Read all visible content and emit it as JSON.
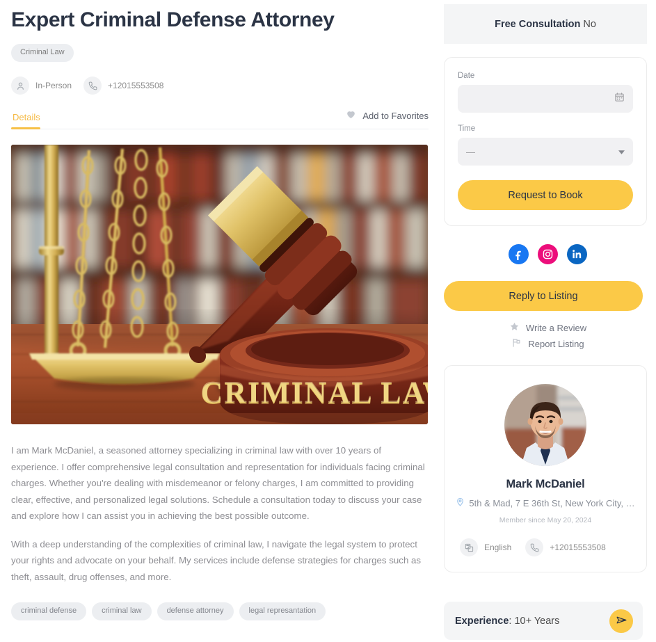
{
  "listing": {
    "title": "Expert Criminal Defense Attorney",
    "category_pill": "Criminal Law",
    "service_type": "In-Person",
    "phone": "+12015553508",
    "hero_image_alt": "CRIMINAL LAW",
    "hero_image_caption": "CRIMINAL LAW"
  },
  "tabs": [
    {
      "label": "Details",
      "active": true
    }
  ],
  "favorites": {
    "label": "Add to Favorites"
  },
  "description": {
    "paragraph_1": "I am Mark McDaniel, a seasoned attorney specializing in criminal law with over 10 years of experience. I offer comprehensive legal consultation and representation for individuals facing criminal charges. Whether you're dealing with misdemeanor or felony charges, I am committed to providing clear, effective, and personalized legal solutions. Schedule a consultation today to discuss your case and explore how I can assist you in achieving the best possible outcome.",
    "paragraph_2": "With a deep understanding of the complexities of criminal law, I navigate the legal system to protect your rights and advocate on your behalf. My services include defense strategies for charges such as theft, assault, drug offenses, and more."
  },
  "tags": [
    "criminal defense",
    "criminal law",
    "defense attorney",
    "legal represantation"
  ],
  "sidebar": {
    "free_consultation_label": "Free Consultation",
    "free_consultation_value": "No",
    "booking": {
      "date_label": "Date",
      "date_value": "",
      "time_label": "Time",
      "time_value": "—",
      "submit_label": "Request to Book"
    },
    "social": [
      {
        "name": "facebook",
        "color": "#1877F2",
        "label": "Facebook"
      },
      {
        "name": "instagram",
        "color": "#EC0E7B",
        "label": "Instagram"
      },
      {
        "name": "linkedin",
        "color": "#0A66C2",
        "label": "LinkedIn"
      }
    ],
    "reply_label": "Reply to Listing",
    "links": [
      {
        "label": "Write a Review",
        "icon": "star-icon"
      },
      {
        "label": "Report Listing",
        "icon": "flag-icon"
      }
    ],
    "profile": {
      "name": "Mark McDaniel",
      "address": "5th & Mad, 7 E 36th St, New York City, …",
      "member_since": "Member since May 20, 2024",
      "language": "English",
      "phone": "+12015553508"
    },
    "experience": {
      "label": "Experience",
      "value": "10+ Years"
    }
  },
  "colors": {
    "accent": "#fbc947",
    "tab_active": "#f5b942",
    "text_dark": "#2b3445",
    "text_muted": "#8e8e93"
  }
}
